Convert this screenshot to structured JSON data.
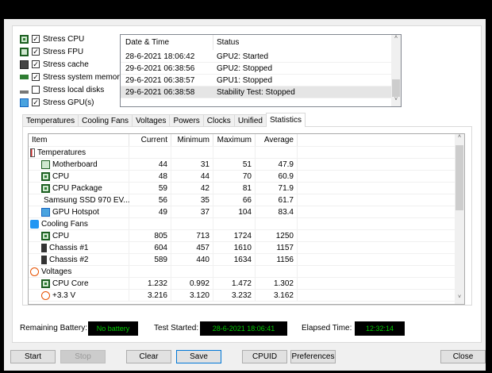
{
  "options": [
    {
      "label": "Stress CPU",
      "checked": true,
      "icon": "cpu-icon"
    },
    {
      "label": "Stress FPU",
      "checked": true,
      "icon": "fpu-icon"
    },
    {
      "label": "Stress cache",
      "checked": true,
      "icon": "cache-icon"
    },
    {
      "label": "Stress system memory",
      "checked": true,
      "icon": "memory-icon"
    },
    {
      "label": "Stress local disks",
      "checked": false,
      "icon": "disk-icon"
    },
    {
      "label": "Stress GPU(s)",
      "checked": true,
      "icon": "gpu-icon"
    }
  ],
  "log": {
    "headers": [
      "Date & Time",
      "Status"
    ],
    "rows": [
      [
        "28-6-2021 18:06:42",
        "GPU2: Started"
      ],
      [
        "29-6-2021 06:38:56",
        "GPU2: Stopped"
      ],
      [
        "29-6-2021 06:38:57",
        "GPU1: Stopped"
      ],
      [
        "29-6-2021 06:38:58",
        "Stability Test: Stopped"
      ]
    ]
  },
  "tabs": [
    "Temperatures",
    "Cooling Fans",
    "Voltages",
    "Powers",
    "Clocks",
    "Unified",
    "Statistics"
  ],
  "active_tab": "Statistics",
  "stats": {
    "headers": [
      "Item",
      "Current",
      "Minimum",
      "Maximum",
      "Average"
    ],
    "rows": [
      {
        "type": "group",
        "name": "Temperatures",
        "icon": "thermometer-icon"
      },
      {
        "type": "item",
        "name": "Motherboard",
        "icon": "motherboard-icon",
        "v": [
          "44",
          "31",
          "51",
          "47.9"
        ]
      },
      {
        "type": "item",
        "name": "CPU",
        "icon": "cpu-icon",
        "v": [
          "48",
          "44",
          "70",
          "60.9"
        ]
      },
      {
        "type": "item",
        "name": "CPU Package",
        "icon": "cpu-icon",
        "v": [
          "59",
          "42",
          "81",
          "71.9"
        ]
      },
      {
        "type": "item",
        "name": "Samsung SSD 970 EV...",
        "icon": "disk-icon",
        "v": [
          "56",
          "35",
          "66",
          "61.7"
        ]
      },
      {
        "type": "item",
        "name": "GPU Hotspot",
        "icon": "gpu-icon",
        "v": [
          "49",
          "37",
          "104",
          "83.4"
        ]
      },
      {
        "type": "group",
        "name": "Cooling Fans",
        "icon": "fan-icon"
      },
      {
        "type": "item",
        "name": "CPU",
        "icon": "cpu-icon",
        "v": [
          "805",
          "713",
          "1724",
          "1250"
        ]
      },
      {
        "type": "item",
        "name": "Chassis #1",
        "icon": "chassis-icon",
        "v": [
          "604",
          "457",
          "1610",
          "1157"
        ]
      },
      {
        "type": "item",
        "name": "Chassis #2",
        "icon": "chassis-icon",
        "v": [
          "589",
          "440",
          "1634",
          "1156"
        ]
      },
      {
        "type": "group",
        "name": "Voltages",
        "icon": "voltage-icon"
      },
      {
        "type": "item",
        "name": "CPU Core",
        "icon": "cpu-icon",
        "v": [
          "1.232",
          "0.992",
          "1.472",
          "1.302"
        ]
      },
      {
        "type": "item",
        "name": "+3.3 V",
        "icon": "voltage-icon",
        "v": [
          "3.216",
          "3.120",
          "3.232",
          "3.162"
        ]
      }
    ]
  },
  "status": {
    "battery_label": "Remaining Battery:",
    "battery": "No battery",
    "started_label": "Test Started:",
    "started": "28-6-2021 18:06:41",
    "elapsed_label": "Elapsed Time:",
    "elapsed": "12:32:14"
  },
  "buttons": {
    "start": "Start",
    "stop": "Stop",
    "clear": "Clear",
    "save": "Save",
    "cpuid": "CPUID",
    "preferences": "Preferences",
    "close": "Close"
  },
  "colors": {
    "status_text": "#00cc00",
    "status_bg": "#000000",
    "accent": "#0078d7"
  }
}
